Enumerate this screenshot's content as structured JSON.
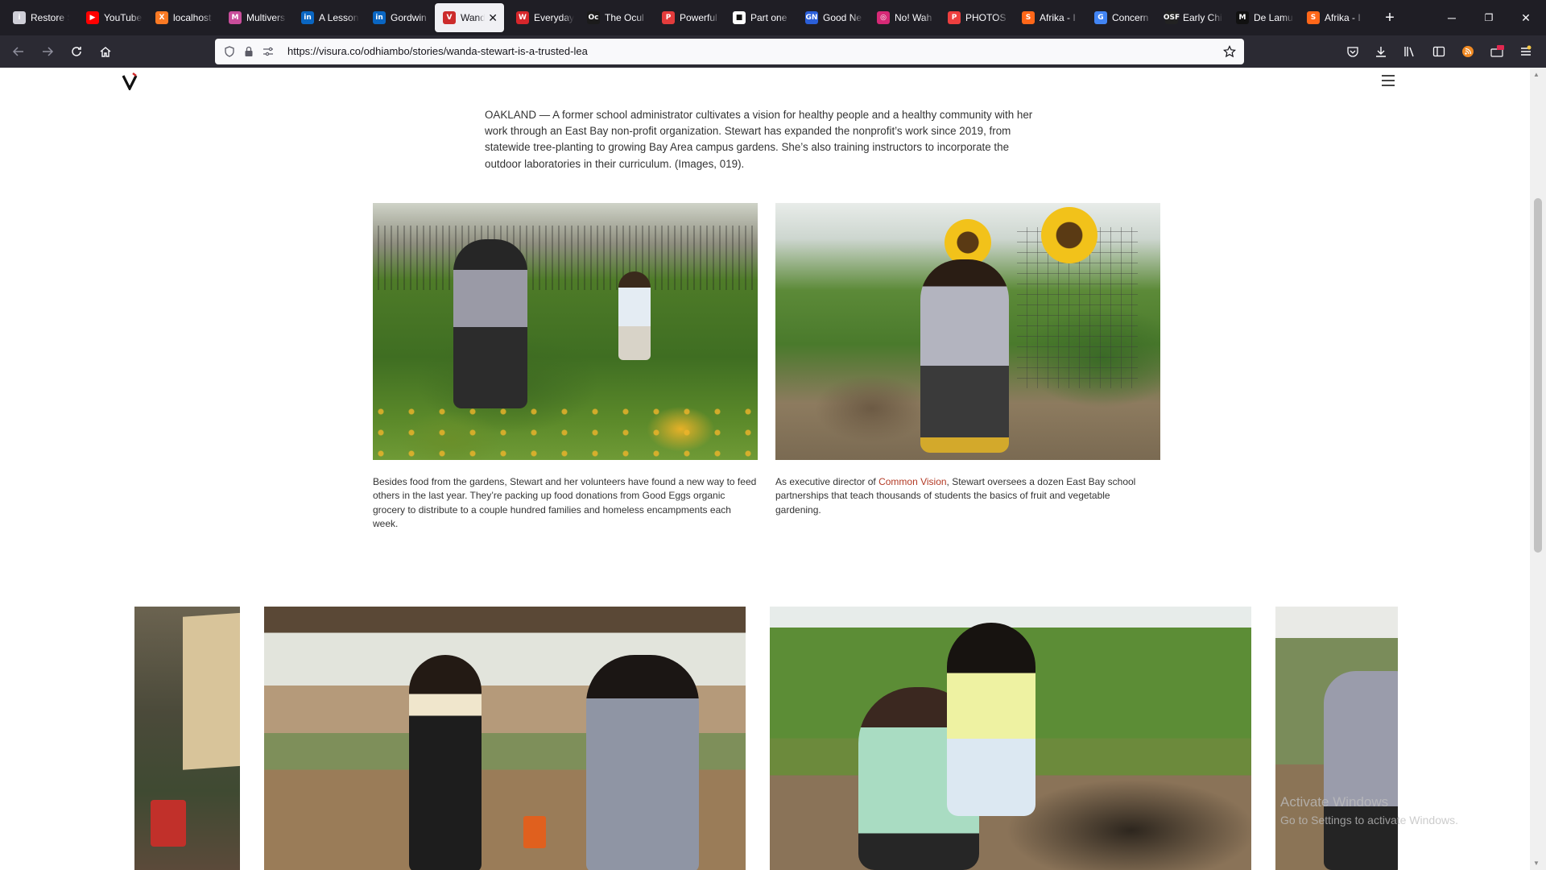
{
  "browser": {
    "tabs": [
      {
        "label": "Restore S",
        "icon": "info-icon",
        "color": "#cfcfd8"
      },
      {
        "label": "YouTube",
        "icon": "youtube-icon",
        "color": "#ff0000"
      },
      {
        "label": "localhost",
        "icon": "xampp-icon",
        "color": "#fb7a24"
      },
      {
        "label": "Multivers",
        "icon": "multiverse-icon",
        "color": "#c94d9b"
      },
      {
        "label": "A Lesson",
        "icon": "linkedin-icon",
        "color": "#0a66c2"
      },
      {
        "label": "Gordwin",
        "icon": "linkedin-icon",
        "color": "#0a66c2"
      },
      {
        "label": "Wand",
        "icon": "visura-icon",
        "color": "#cc2b2b",
        "active": true
      },
      {
        "label": "Everyday",
        "icon": "w-icon",
        "color": "#d6262b"
      },
      {
        "label": "The Ocul",
        "icon": "oc-icon",
        "color": "#1b1b1b"
      },
      {
        "label": "Powerful",
        "icon": "powerful-icon",
        "color": "#e33c3c"
      },
      {
        "label": "Part one",
        "icon": "square-icon",
        "color": "#ffffff"
      },
      {
        "label": "Good Ne",
        "icon": "gn-icon",
        "color": "#2b5fd9"
      },
      {
        "label": "No! Wah",
        "icon": "instagram-icon",
        "color": "#d62976"
      },
      {
        "label": "PHOTOS",
        "icon": "photos-icon",
        "color": "#ee3f3f"
      },
      {
        "label": "Afrika - I",
        "icon": "substack-icon",
        "color": "#ff6719"
      },
      {
        "label": "Concern",
        "icon": "g-icon",
        "color": "#4285f4"
      },
      {
        "label": "Early Chi",
        "icon": "osf-icon",
        "color": "#222222"
      },
      {
        "label": "De Lamu",
        "icon": "m-icon",
        "color": "#111111"
      },
      {
        "label": "Afrika - I",
        "icon": "substack-icon",
        "color": "#ff6719"
      }
    ],
    "new_tab": "+",
    "window": {
      "minimize": "─",
      "restore": "❐",
      "close": "✕"
    },
    "url": "https://visura.co/odhiambo/stories/wanda-stewart-is-a-trusted-lea"
  },
  "article": {
    "intro": "OAKLAND — A former school administrator cultivates a vision for healthy people and a healthy community with her work through an East Bay non-profit organization. Stewart has expanded the nonprofit’s work since 2019, from statewide tree-planting to growing Bay Area campus gardens. She’s also training instructors to incorporate the outdoor laboratories in their curriculum. (Images, 019).",
    "caption_left": "Besides food from the gardens, Stewart and her volunteers have found a new way to feed others in the last year. They’re packing up food donations from Good Eggs organic grocery to distribute to a couple hundred families and homeless encampments each week.",
    "caption_right_before": "As executive director of ",
    "caption_right_link": "Common Vision",
    "caption_right_after": ", Stewart oversees a dozen East Bay school partnerships that teach thousands of students the basics of fruit and vegetable gardening.",
    "link_color": "#b33a25"
  },
  "os": {
    "watermark_line1": "Activate Windows",
    "watermark_line2": "Go to Settings to activate Windows."
  }
}
